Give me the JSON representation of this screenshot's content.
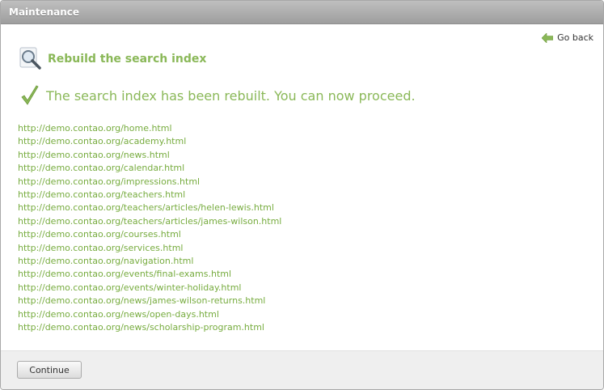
{
  "window": {
    "title": "Maintenance"
  },
  "nav": {
    "go_back_label": "Go back",
    "go_back_icon": "arrow-left-icon"
  },
  "section": {
    "heading": "Rebuild the search index",
    "heading_icon": "magnifier-icon"
  },
  "status": {
    "message": "The search index has been rebuilt. You can now proceed.",
    "icon": "checkmark-icon"
  },
  "urls": [
    "http://demo.contao.org/home.html",
    "http://demo.contao.org/academy.html",
    "http://demo.contao.org/news.html",
    "http://demo.contao.org/calendar.html",
    "http://demo.contao.org/impressions.html",
    "http://demo.contao.org/teachers.html",
    "http://demo.contao.org/teachers/articles/helen-lewis.html",
    "http://demo.contao.org/teachers/articles/james-wilson.html",
    "http://demo.contao.org/courses.html",
    "http://demo.contao.org/services.html",
    "http://demo.contao.org/navigation.html",
    "http://demo.contao.org/events/final-exams.html",
    "http://demo.contao.org/events/winter-holiday.html",
    "http://demo.contao.org/news/james-wilson-returns.html",
    "http://demo.contao.org/news/open-days.html",
    "http://demo.contao.org/news/scholarship-program.html"
  ],
  "footer": {
    "continue_label": "Continue"
  },
  "colors": {
    "accent_green": "#8ab858",
    "link_green": "#77ac3f",
    "titlebar_gray": "#a8a8a8"
  }
}
